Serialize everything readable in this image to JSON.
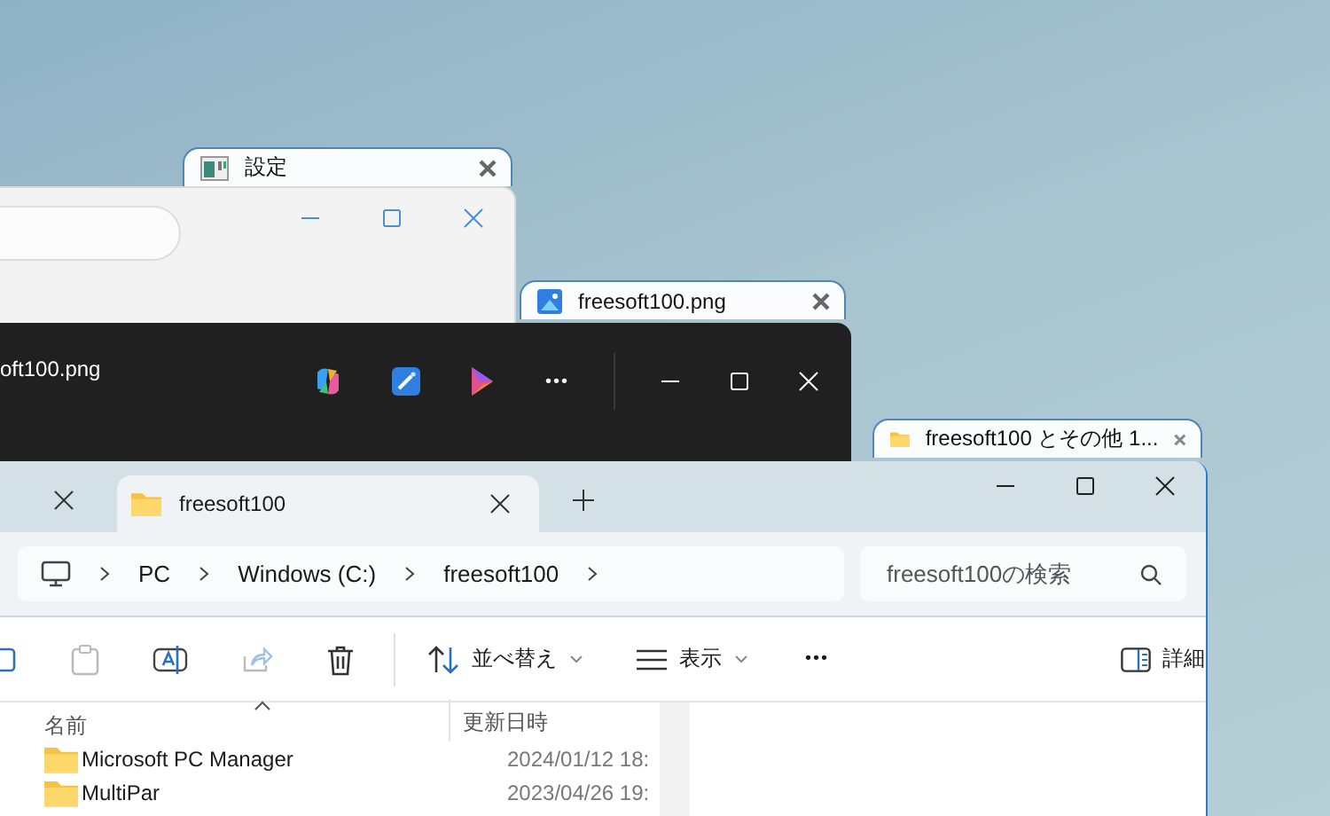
{
  "settings_window": {
    "tab_title": "設定"
  },
  "photos_window": {
    "tab_title": "freesoft100.png",
    "title": "oft100.png"
  },
  "explorer_window": {
    "tab_title": "freesoft100 とその他 1...",
    "tabs": [
      {
        "label": "freesoft100",
        "selected": true
      }
    ],
    "breadcrumb": [
      "PC",
      "Windows (C:)",
      "freesoft100"
    ],
    "search": {
      "placeholder": "freesoft100の検索"
    },
    "toolbar": {
      "sort": "並べ替え",
      "view": "表示",
      "more": "•••",
      "details": "詳細"
    },
    "columns": [
      "名前",
      "更新日時"
    ],
    "rows": [
      {
        "name": "Microsoft PC Manager",
        "date": "2024/01/12 18:"
      },
      {
        "name": "MultiPar",
        "date": "2023/04/26 19:"
      }
    ]
  }
}
